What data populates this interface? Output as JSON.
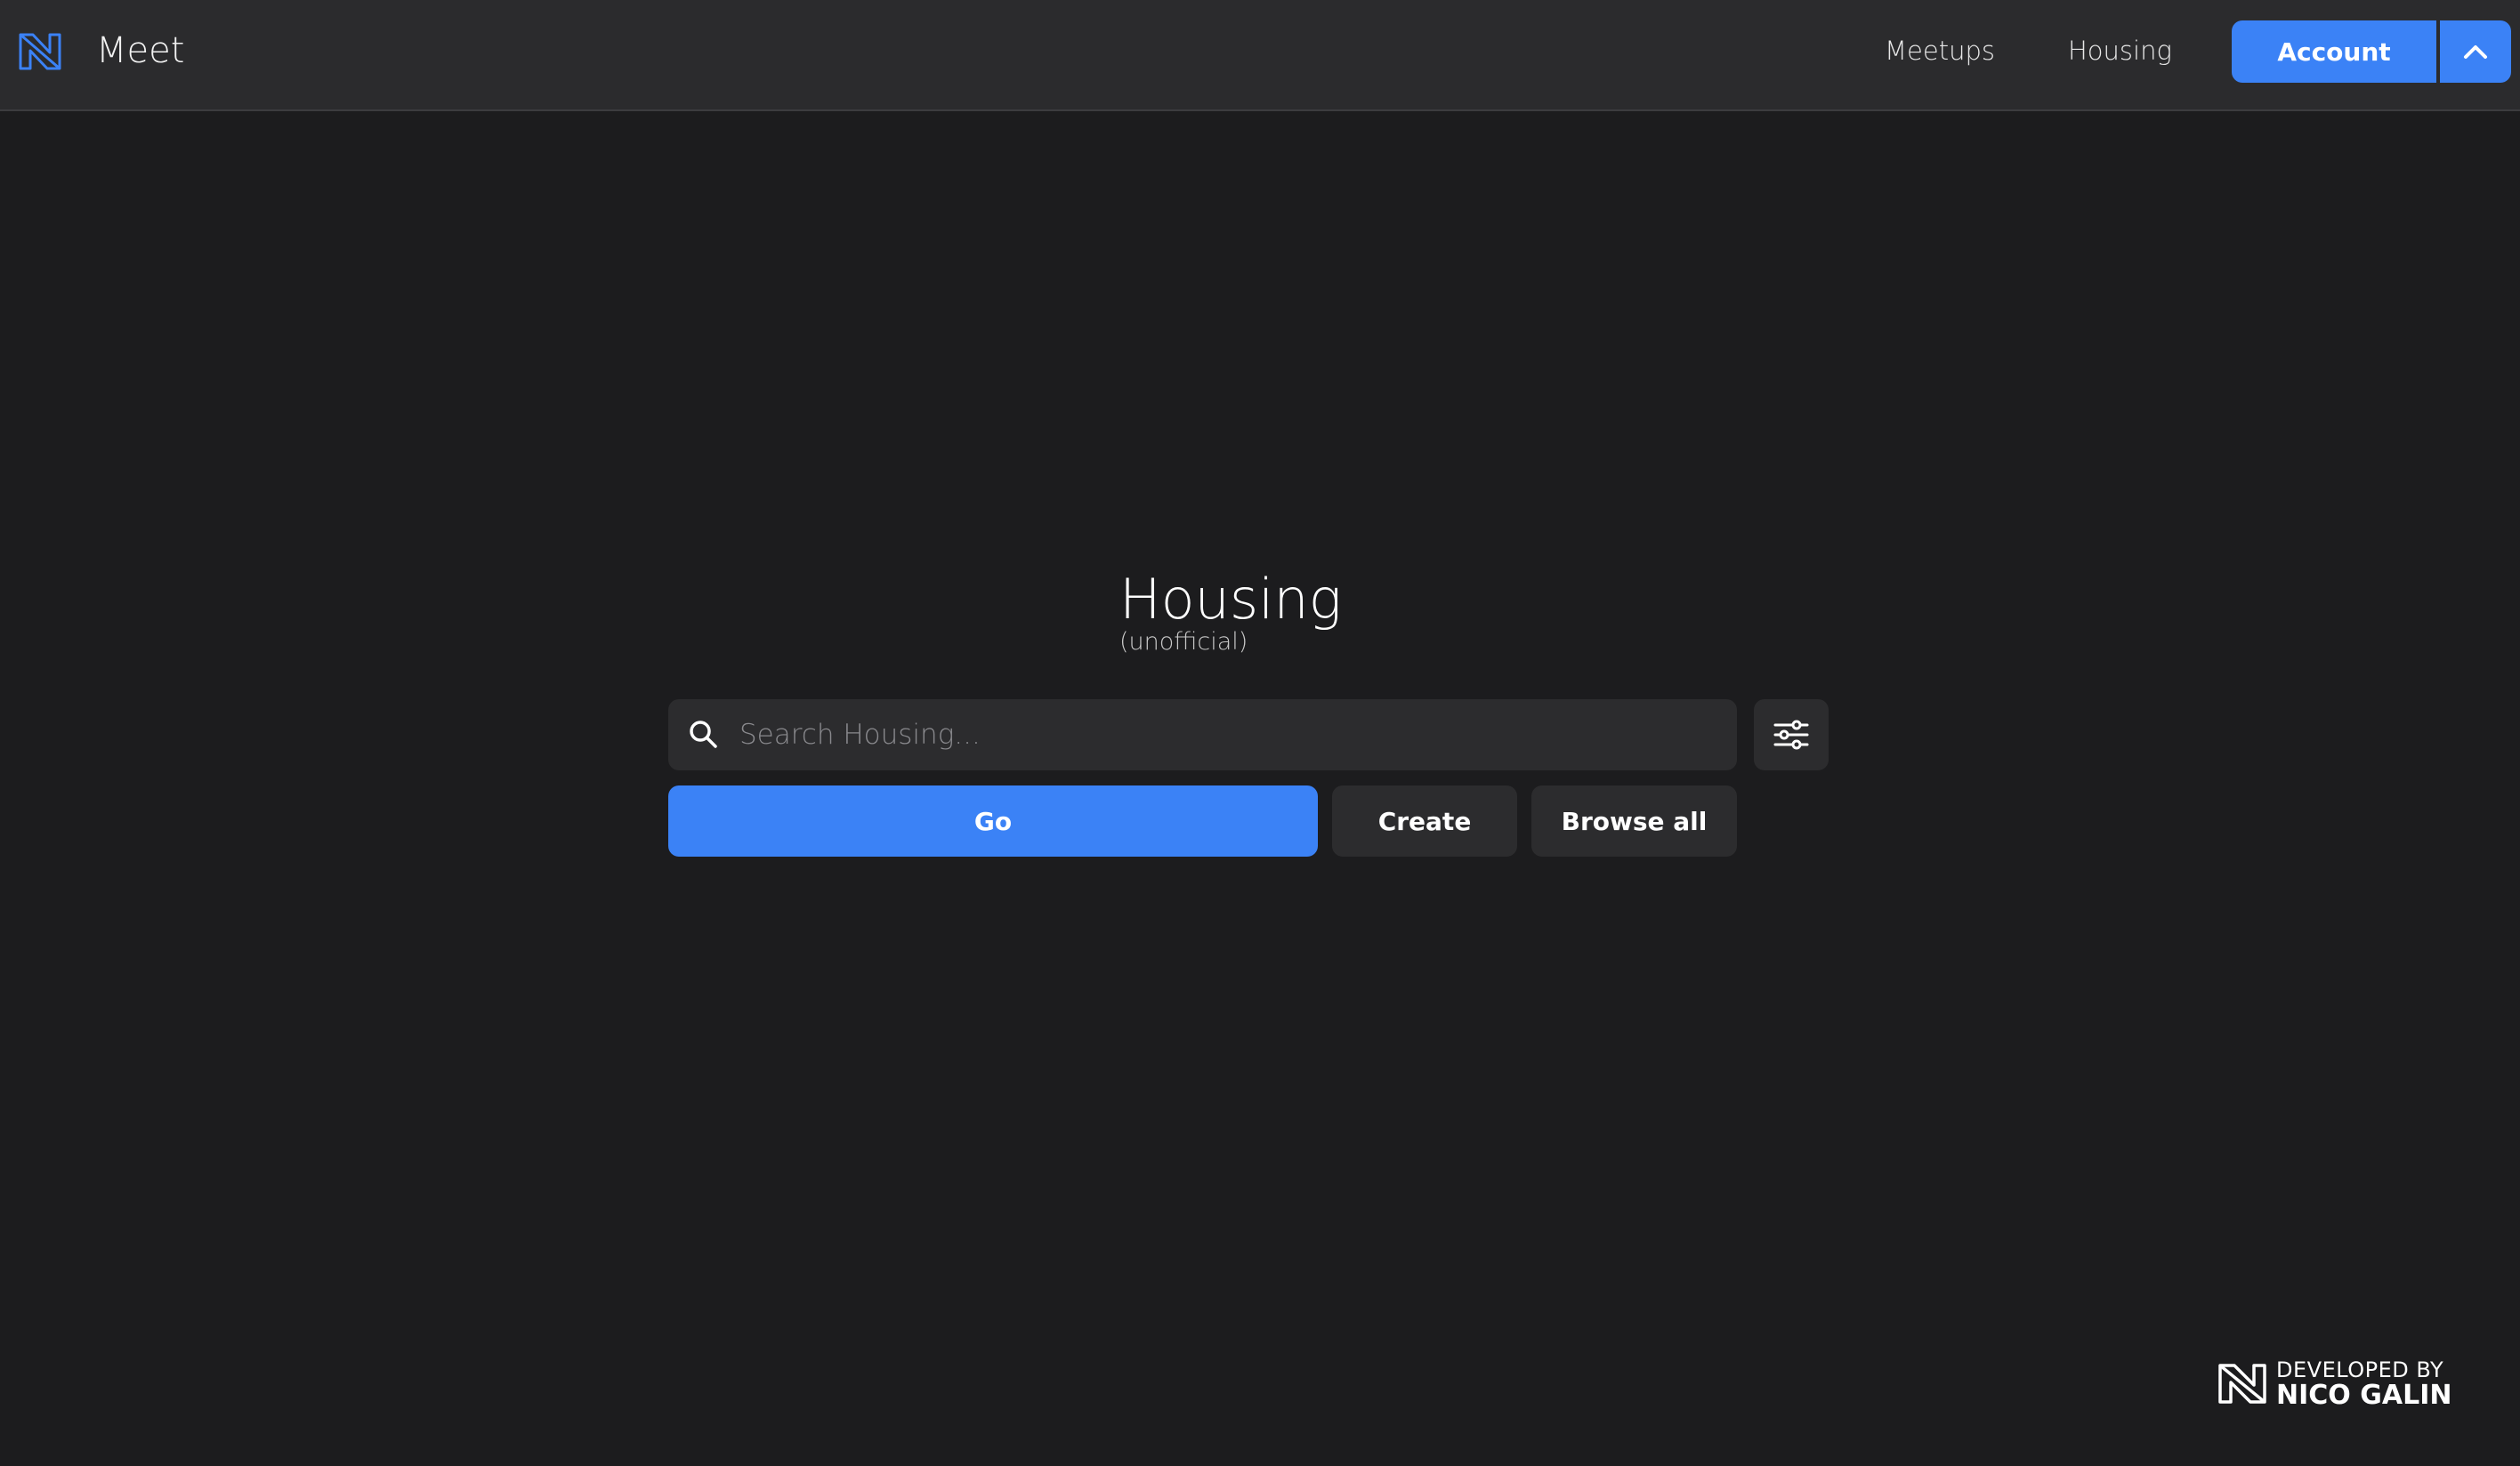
{
  "header": {
    "brand_name": "Meet",
    "logo_icon": "n-monogram-logo",
    "nav": [
      {
        "label": "Meetups"
      },
      {
        "label": "Housing"
      }
    ],
    "account_label": "Account",
    "account_toggle_icon": "chevron-up-icon"
  },
  "main": {
    "title": "Housing",
    "subtitle": "(unofficial)",
    "search": {
      "placeholder": "Search Housing...",
      "value": "",
      "icon": "search-icon"
    },
    "filter_icon": "sliders-icon",
    "buttons": {
      "go": "Go",
      "create": "Create",
      "browse_all": "Browse all"
    }
  },
  "footer": {
    "developed_by": "DEVELOPED BY",
    "developer": "NICO GALIN",
    "logo_icon": "n-monogram-logo"
  },
  "colors": {
    "accent": "#3b82f6",
    "background": "#1c1c1e",
    "surface": "#2c2c2e",
    "topbar": "#2b2b2d"
  }
}
